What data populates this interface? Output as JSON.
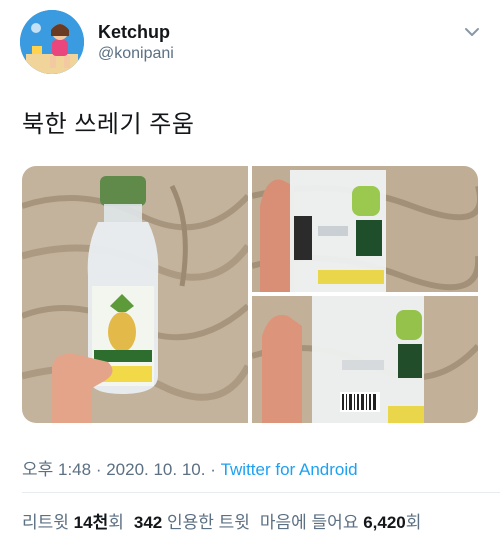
{
  "user": {
    "name": "Ketchup",
    "handle": "@konipani"
  },
  "tweet": {
    "text": "북한 쓰레기 주움"
  },
  "meta": {
    "time": "오후 1:48",
    "sep1": " · ",
    "date": "2020. 10. 10.",
    "sep2": " · ",
    "source": "Twitter for Android"
  },
  "stats": {
    "retweets_label": "리트윗 ",
    "retweets_value": "14천",
    "retweets_unit": "회",
    "quotes_value": "342",
    "quotes_label": " 인용한 트윗",
    "likes_label": "마음에 들어요 ",
    "likes_value": "6,420",
    "likes_unit": "회"
  },
  "colors": {
    "link": "#1da1f2",
    "secondary_text": "#5b7083",
    "primary_text": "#14171a"
  },
  "icons": {
    "more": "chevron-down-icon"
  }
}
